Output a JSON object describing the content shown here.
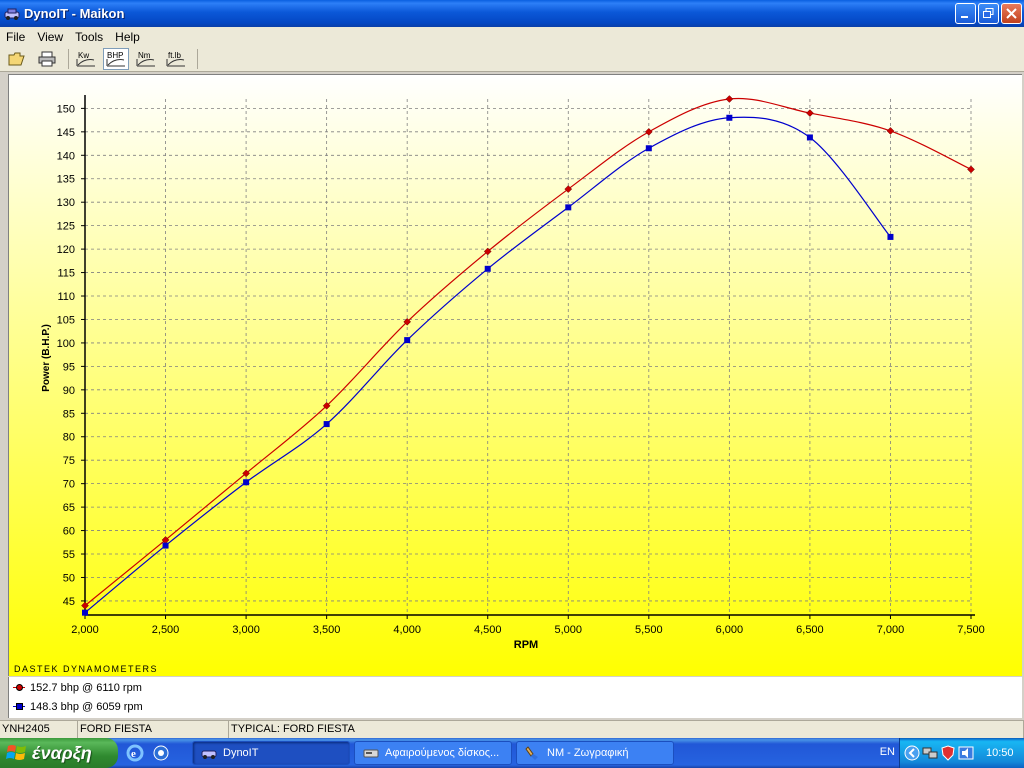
{
  "window": {
    "title": "DynoIT - Maikon"
  },
  "menu": [
    "File",
    "View",
    "Tools",
    "Help"
  ],
  "toolbar": {
    "buttons": [
      {
        "name": "open-icon"
      },
      {
        "name": "print-icon"
      },
      {
        "name": "kw-icon",
        "label": "Kw"
      },
      {
        "name": "bhp-icon",
        "label": "BHP",
        "active": true
      },
      {
        "name": "nm-icon",
        "label": "Nm"
      },
      {
        "name": "ftlb-icon",
        "label": "ft.lb"
      }
    ]
  },
  "chart_data": {
    "type": "line",
    "xlabel": "RPM",
    "ylabel": "Power (B.H.P.)",
    "xlim": [
      2000,
      7500
    ],
    "ylim": [
      42,
      152
    ],
    "x_ticks": [
      "2,000",
      "2,500",
      "3,000",
      "3,500",
      "4,000",
      "4,500",
      "5,000",
      "5,500",
      "6,000",
      "6,500",
      "7,000",
      "7,500"
    ],
    "y_ticks": [
      45,
      50,
      55,
      60,
      65,
      70,
      75,
      80,
      85,
      90,
      95,
      100,
      105,
      110,
      115,
      120,
      125,
      130,
      135,
      140,
      145,
      150
    ],
    "grid": true,
    "series": [
      {
        "name": "152.7 bhp @ 6110 rpm",
        "color": "#cc0000",
        "marker": "diamond",
        "x": [
          2000,
          2500,
          3000,
          3500,
          4000,
          4500,
          5000,
          5500,
          6000,
          6500,
          7000,
          7500
        ],
        "y": [
          44,
          58,
          72.2,
          86.6,
          104.5,
          119.5,
          132.8,
          145,
          152,
          149,
          145.2,
          137
        ]
      },
      {
        "name": "148.3 bhp @ 6059 rpm",
        "color": "#0000cc",
        "marker": "square",
        "x": [
          2000,
          2500,
          3000,
          3500,
          4000,
          4500,
          5000,
          5500,
          6000,
          6500,
          7000
        ],
        "y": [
          42.5,
          56.8,
          70.3,
          82.7,
          100.6,
          115.8,
          128.9,
          141.5,
          148,
          143.8,
          122.6
        ]
      }
    ],
    "footer": "DASTEK DYNAMOMETERS"
  },
  "status": [
    "YNH2405",
    "FORD FIESTA",
    "TYPICAL: FORD FIESTA"
  ],
  "taskbar": {
    "start_label": "έναρξη",
    "tasks": [
      {
        "label": "DynoIT",
        "active": true
      },
      {
        "label": "Αφαιρούμενος δίσκος..."
      },
      {
        "label": "NM - Ζωγραφική"
      }
    ],
    "lang": "EN",
    "clock": "10:50"
  }
}
